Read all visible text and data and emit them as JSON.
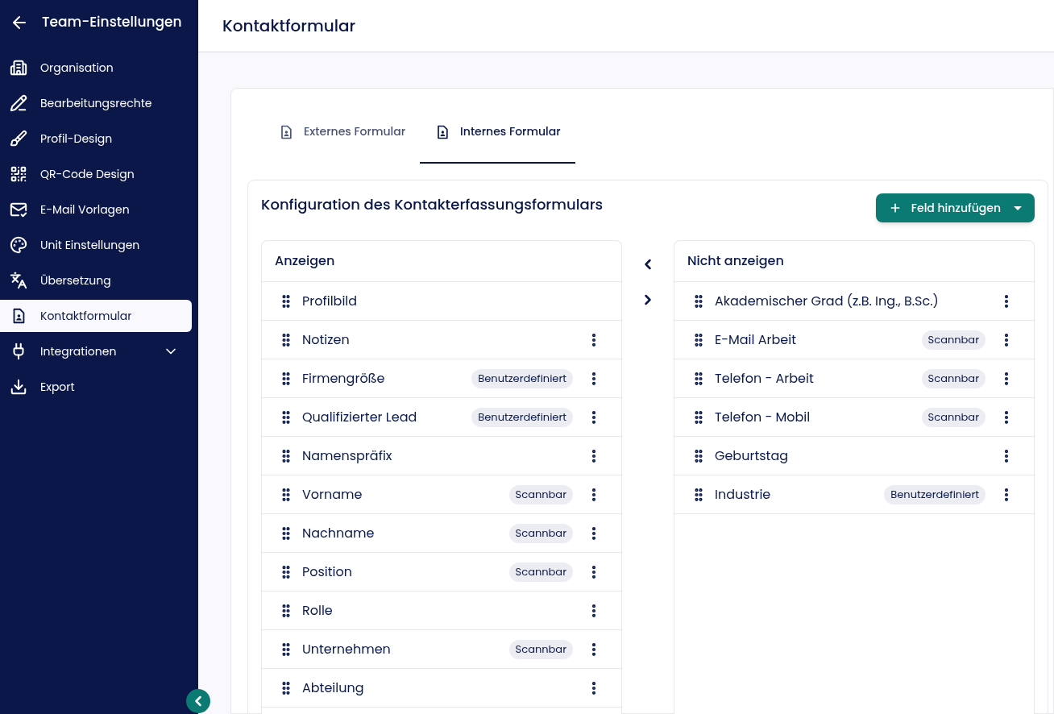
{
  "sidebar": {
    "title": "Team-Einstellungen",
    "items": [
      {
        "kind": "building",
        "label": "Organisation",
        "selected": false
      },
      {
        "kind": "pencil",
        "label": "Bearbeitungsrechte",
        "selected": false
      },
      {
        "kind": "brush",
        "label": "Profil-Design",
        "selected": false
      },
      {
        "kind": "qr",
        "label": "QR-Code Design",
        "selected": false
      },
      {
        "kind": "mail",
        "label": "E-Mail Vorlagen",
        "selected": false
      },
      {
        "kind": "palette",
        "label": "Unit Einstellungen",
        "selected": false
      },
      {
        "kind": "translate",
        "label": "Übersetzung",
        "selected": false
      },
      {
        "kind": "form",
        "label": "Kontaktformular",
        "selected": true
      },
      {
        "kind": "plug",
        "label": "Integrationen",
        "selected": false,
        "expanded": false
      },
      {
        "kind": "download",
        "label": "Export",
        "selected": false
      }
    ]
  },
  "header": {
    "title": "Kontaktformular"
  },
  "tabs": [
    {
      "label": "Externes Formular",
      "selected": false
    },
    {
      "label": "Internes Formular",
      "selected": true
    }
  ],
  "config": {
    "title": "Konfiguration des Kontakterfassungsformulars",
    "add_button": "Feld hinzufügen",
    "shown": {
      "title": "Anzeigen",
      "rows": [
        {
          "label": "Profilbild",
          "has_menu": false
        },
        {
          "label": "Notizen",
          "has_menu": true
        },
        {
          "label": "Firmengröße",
          "badge": "Benutzerdefiniert",
          "has_menu": true
        },
        {
          "label": "Qualifizierter Lead",
          "badge": "Benutzerdefiniert",
          "has_menu": true
        },
        {
          "label": "Namenspräfix",
          "has_menu": true
        },
        {
          "label": "Vorname",
          "badge": "Scannbar",
          "has_menu": true
        },
        {
          "label": "Nachname",
          "badge": "Scannbar",
          "has_menu": true
        },
        {
          "label": "Position",
          "badge": "Scannbar",
          "has_menu": true
        },
        {
          "label": "Rolle",
          "has_menu": true
        },
        {
          "label": "Unternehmen",
          "badge": "Scannbar",
          "has_menu": true
        },
        {
          "label": "Abteilung",
          "has_menu": true
        }
      ]
    },
    "hidden": {
      "title": "Nicht anzeigen",
      "rows": [
        {
          "label": "Akademischer Grad (z.B. Ing., B.Sc.)",
          "has_menu": true
        },
        {
          "label": "E-Mail Arbeit",
          "badge": "Scannbar",
          "has_menu": true
        },
        {
          "label": "Telefon - Arbeit",
          "badge": "Scannbar",
          "has_menu": true
        },
        {
          "label": "Telefon - Mobil",
          "badge": "Scannbar",
          "has_menu": true
        },
        {
          "label": "Geburtstag",
          "has_menu": true
        },
        {
          "label": "Industrie",
          "badge": "Benutzerdefiniert",
          "has_menu": true
        }
      ]
    }
  }
}
